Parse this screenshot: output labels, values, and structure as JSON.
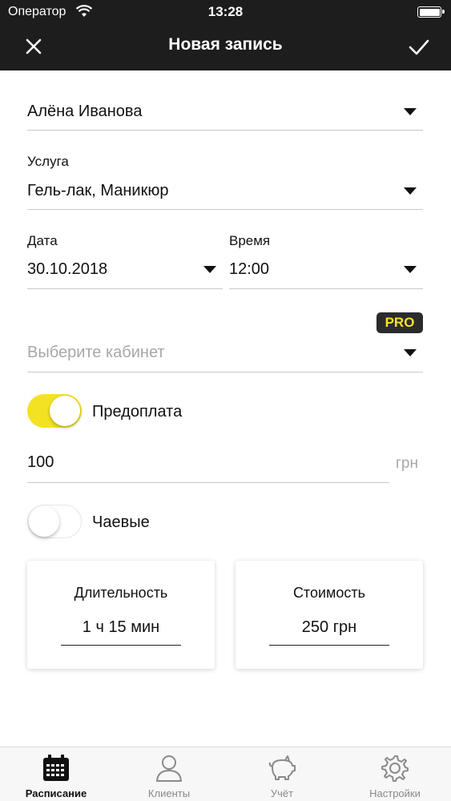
{
  "status_bar": {
    "carrier": "Оператор",
    "time": "13:28"
  },
  "nav": {
    "title": "Новая запись",
    "close_icon": "close-icon",
    "done_icon": "checkmark-icon"
  },
  "form": {
    "client": {
      "value": "Алёна Иванова"
    },
    "service": {
      "label": "Услуга",
      "value": "Гель-лак, Маникюр"
    },
    "date": {
      "label": "Дата",
      "value": "30.10.2018"
    },
    "time": {
      "label": "Время",
      "value": "12:00"
    },
    "cabinet": {
      "badge": "PRO",
      "placeholder": "Выберите кабинет"
    },
    "prepayment": {
      "label": "Предоплата",
      "enabled": true,
      "amount": "100",
      "unit": "грн"
    },
    "tips": {
      "label": "Чаевые",
      "enabled": false
    }
  },
  "cards": {
    "duration": {
      "title": "Длительность",
      "value": "1 ч 15 мин"
    },
    "cost": {
      "title": "Стоимость",
      "value": "250 грн"
    }
  },
  "tabbar": {
    "items": [
      {
        "label": "Расписание",
        "icon": "calendar-icon",
        "active": true
      },
      {
        "label": "Клиенты",
        "icon": "person-icon",
        "active": false
      },
      {
        "label": "Учёт",
        "icon": "piggy-bank-icon",
        "active": false
      },
      {
        "label": "Настройки",
        "icon": "gear-icon",
        "active": false
      }
    ]
  },
  "colors": {
    "accent": "#f3e224",
    "header": "#1d1d1d",
    "placeholder": "#a7a7a7"
  }
}
